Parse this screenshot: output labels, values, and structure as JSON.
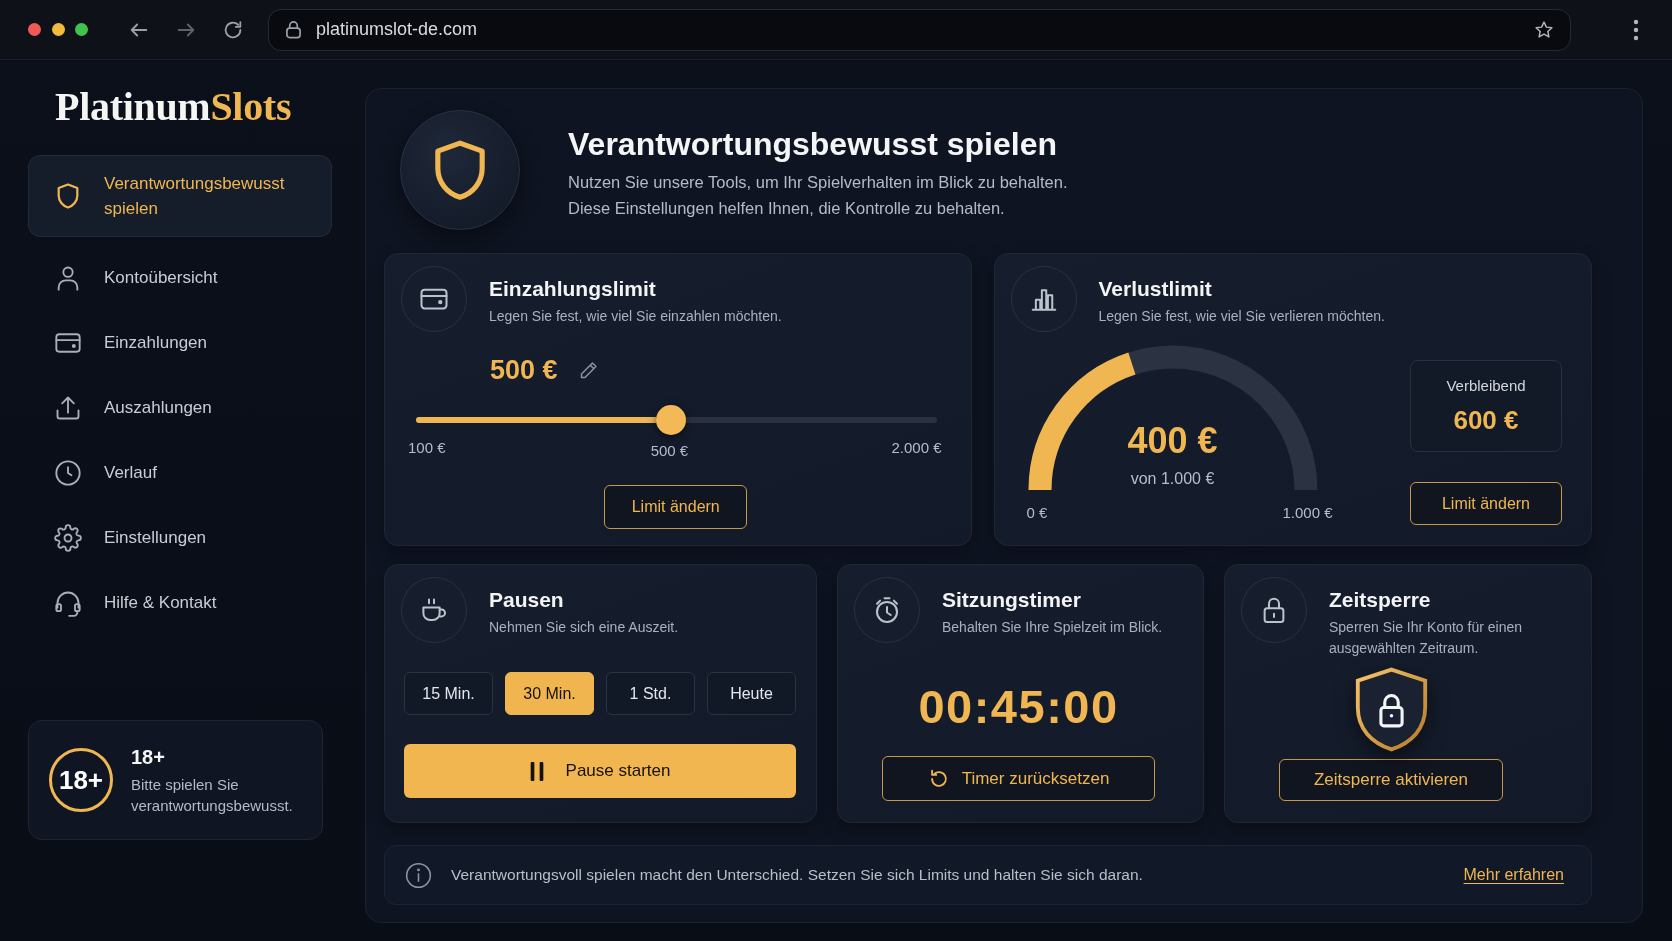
{
  "browser": {
    "url": "platinumslot-de.com"
  },
  "sidebar": {
    "logo": {
      "main": "Platinum",
      "accent": "Slots"
    },
    "items": [
      {
        "label": "Verantwortungsbewusst spielen",
        "selected": true
      },
      {
        "label": "Kontoübersicht",
        "selected": false
      },
      {
        "label": "Einzahlungen",
        "selected": false
      },
      {
        "label": "Auszahlungen",
        "selected": false
      },
      {
        "label": "Verlauf",
        "selected": false
      },
      {
        "label": "Einstellungen",
        "selected": false
      },
      {
        "label": "Hilfe & Kontakt",
        "selected": false
      }
    ],
    "age_notice": {
      "badge": "18+",
      "title": "18+",
      "text": "Bitte spielen Sie verantwortungsbewusst."
    }
  },
  "header": {
    "title": "Verantwortungsbewusst spielen",
    "description": [
      "Nutzen Sie unsere Tools, um Ihr Spielverhalten im Blick zu behalten.",
      "Diese Einstellungen helfen Ihnen, die Kontrolle zu behalten."
    ]
  },
  "deposit_limit": {
    "title": "Einzahlungslimit",
    "subtitle": "Legen Sie fest, wie viel Sie einzahlen möchten.",
    "value": "500 €",
    "slider": {
      "level": 0.49,
      "min_label": "100 €",
      "value_label": "500 €",
      "max_label": "2.000 €"
    },
    "button": "Limit ändern"
  },
  "loss_limit": {
    "title": "Verlustlimit",
    "subtitle": "Legen Sie fest, wie viel Sie verlieren möchten.",
    "gauge": {
      "level": 0.4,
      "value": "400 €",
      "caption": "von 1.000 €",
      "min_label": "0 €",
      "max_label": "1.000 €"
    },
    "remaining": {
      "label": "Verbleibend",
      "value": "600 €"
    },
    "button": "Limit ändern"
  },
  "breaks": {
    "title": "Pausen",
    "subtitle": "Nehmen Sie sich eine Auszeit.",
    "options": [
      {
        "label": "15 Min.",
        "selected": false
      },
      {
        "label": "30 Min.",
        "selected": true
      },
      {
        "label": "1 Std.",
        "selected": false
      },
      {
        "label": "Heute",
        "selected": false
      }
    ],
    "button": "Pause starten"
  },
  "session_timer": {
    "title": "Sitzungstimer",
    "subtitle": "Behalten Sie Ihre Spielzeit im Blick.",
    "time": "00:45:00",
    "button": "Timer zurücksetzen"
  },
  "time_lock": {
    "title": "Zeitsperre",
    "subtitle": "Sperren Sie Ihr Konto für einen ausgewählten Zeitraum.",
    "button": "Zeitsperre aktivieren"
  },
  "footer": {
    "text": "Verantwortungsvoll spielen macht den Unterschied. Setzen Sie sich Limits und halten Sie sich daran.",
    "link": "Mehr erfahren"
  }
}
